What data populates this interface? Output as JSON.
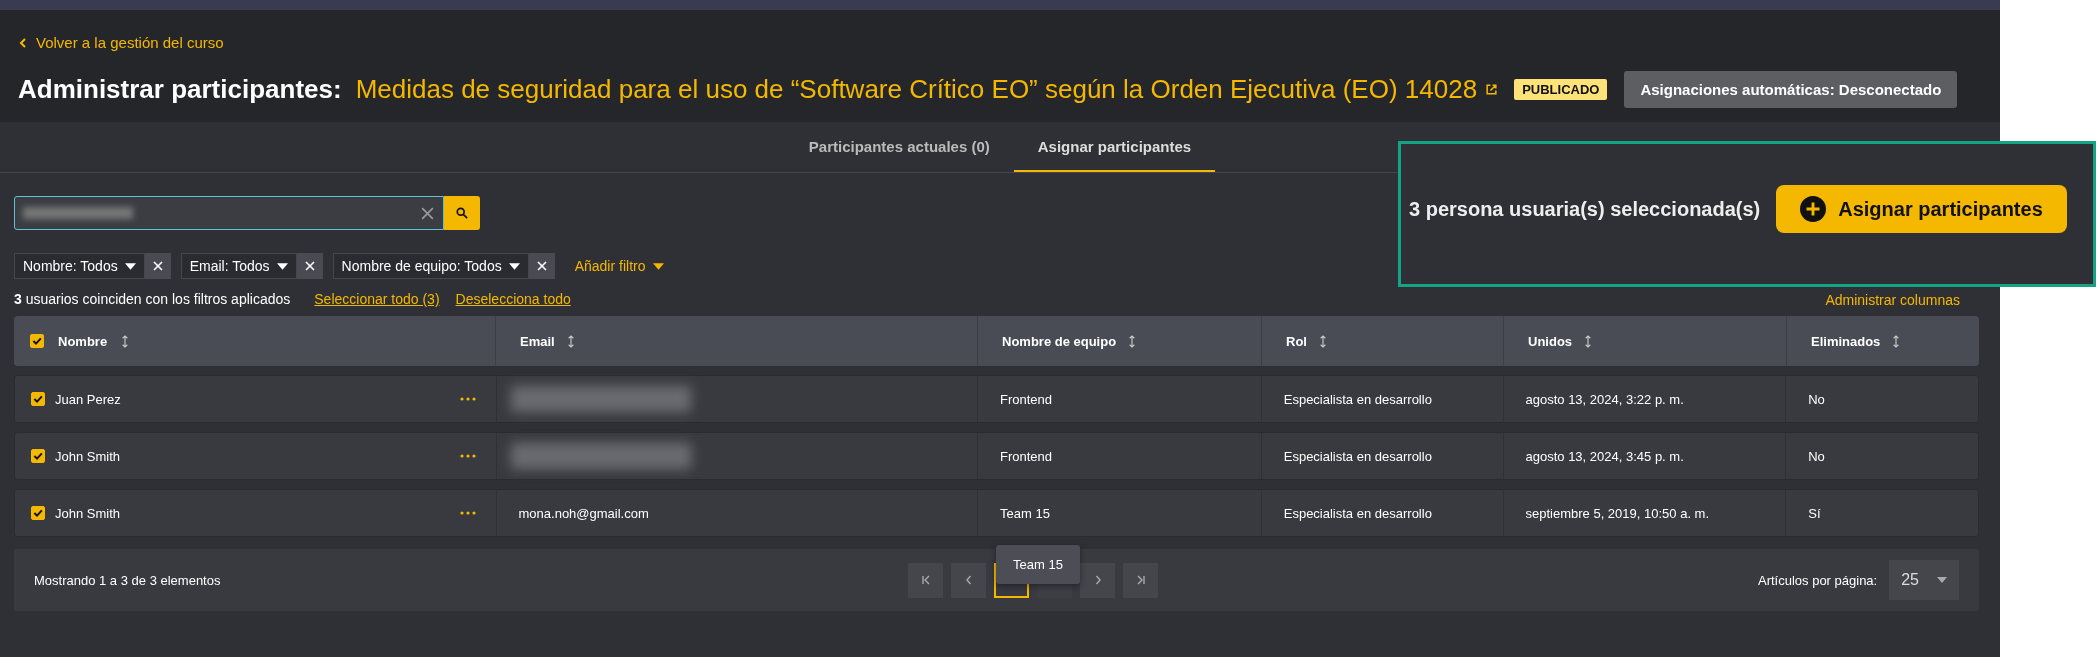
{
  "back_link": "Volver a la gestión del curso",
  "title": {
    "label": "Administrar participantes:",
    "course": "Medidas de seguridad para el uso de “Software Crítico EO” según la Orden Ejecutiva (EO) 14028",
    "status": "PUBLICADO",
    "auto_button": "Asignaciones automáticas: Desconectado"
  },
  "tabs": [
    {
      "label": "Participantes actuales (0)",
      "selected": false
    },
    {
      "label": "Asignar participantes",
      "selected": true
    }
  ],
  "filters": [
    "Nombre: Todos",
    "Email: Todos",
    "Nombre de equipo: Todos"
  ],
  "add_filter": "Añadir filtro",
  "match_text": "**3** usuarios coinciden con los filtros aplicados",
  "select_all": "Seleccionar todo (3)",
  "deselect_all": "Deselecciona todo",
  "manage_columns": "Administrar columnas",
  "table": {
    "all_checked": true,
    "columns": [
      "Nombre",
      "Email",
      "Nombre de equipo",
      "Rol",
      "Unidos",
      "Eliminados"
    ],
    "rows": [
      {
        "checked": true,
        "name": "Juan Perez",
        "email_hidden": true,
        "team": "Frontend",
        "role": "Especialista en desarrollo",
        "joined": "agosto 13, 2024, 3:22 p. m.",
        "deleted": "No"
      },
      {
        "checked": true,
        "name": "John Smith",
        "email_hidden": true,
        "team": "Frontend",
        "role": "Especialista en desarrollo",
        "joined": "agosto 13, 2024, 3:45 p. m.",
        "deleted": "No"
      },
      {
        "checked": true,
        "name": "John Smith",
        "email": "mona.noh@gmail.com",
        "team": "Team 15",
        "role": "Especialista en desarrollo",
        "joined": "septiembre 5, 2019, 10:50 a. m.",
        "deleted": "Sí"
      }
    ]
  },
  "pagination": {
    "summary": "Mostrando 1 a 3 de 3 elementos",
    "pages": [
      {
        "selected": true
      },
      {
        "selected": false
      }
    ],
    "per_page_label": "Artículos por página:",
    "per_page": "25"
  },
  "tooltip": "Team 15",
  "callout": {
    "selected_count": "3 persona usuaria(s) seleccionada(s)",
    "assign_button": "Asignar participantes"
  }
}
